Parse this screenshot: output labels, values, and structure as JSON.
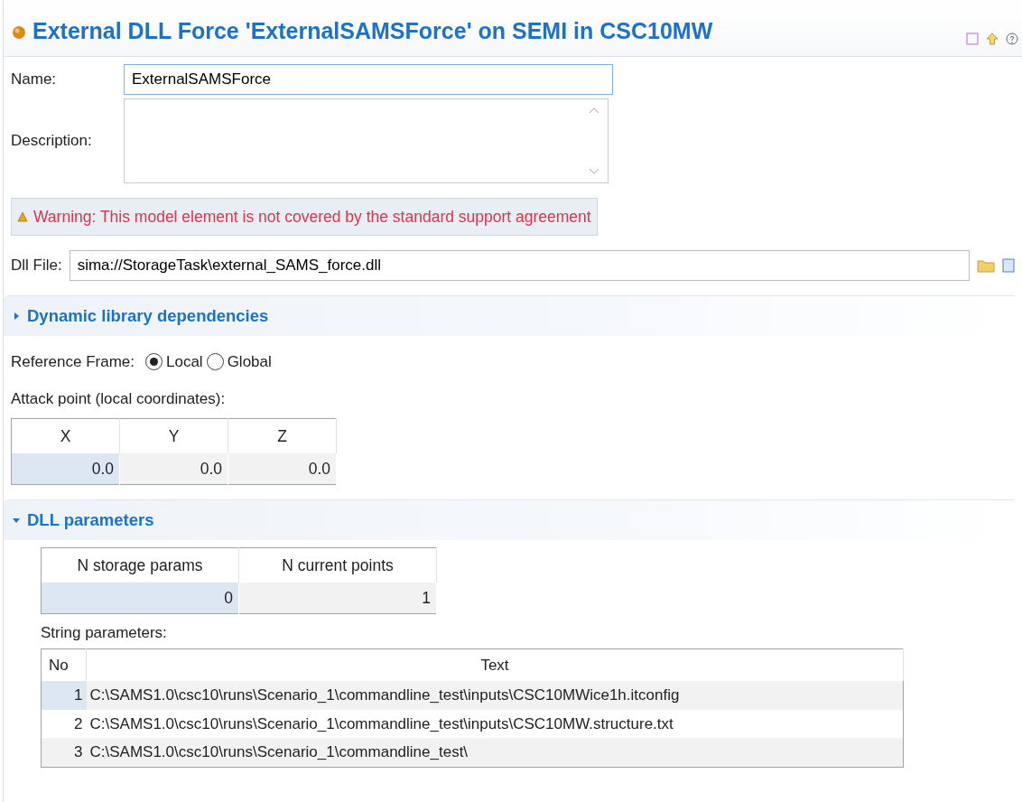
{
  "header": {
    "title": "External DLL Force 'ExternalSAMSForce' on SEMI in CSC10MW"
  },
  "name": {
    "label": "Name:",
    "value": "ExternalSAMSForce"
  },
  "description": {
    "label": "Description:"
  },
  "warning": {
    "text": "Warning: This model element is not covered by the standard support agreement"
  },
  "dll_file": {
    "label": "Dll File:",
    "value": "sima://StorageTask\\external_SAMS_force.dll"
  },
  "dependencies_section": {
    "title": "Dynamic library dependencies",
    "expanded": false
  },
  "reference_frame": {
    "label": "Reference Frame:",
    "options": [
      {
        "label": "Local",
        "selected": true
      },
      {
        "label": "Global",
        "selected": false
      }
    ]
  },
  "attack_point": {
    "label": "Attack point (local coordinates):",
    "columns": [
      "X",
      "Y",
      "Z"
    ],
    "cells": [
      {
        "value": "0.0",
        "selected": true
      },
      {
        "value": "0.0",
        "selected": false
      },
      {
        "value": "0.0",
        "selected": false
      }
    ]
  },
  "dll_parameters_section": {
    "title": "DLL parameters",
    "expanded": true
  },
  "counts_table": {
    "columns": [
      "N storage params",
      "N current points"
    ],
    "cells": [
      {
        "value": "0",
        "selected": true
      },
      {
        "value": "1",
        "selected": false
      }
    ]
  },
  "string_parameters": {
    "label": "String parameters:",
    "columns": [
      "No",
      "Text"
    ],
    "rows": [
      {
        "no": "1",
        "text": "C:\\SAMS1.0\\csc10\\runs\\Scenario_1\\commandline_test\\inputs\\CSC10MWice1h.itconfig",
        "selected": true
      },
      {
        "no": "2",
        "text": "C:\\SAMS1.0\\csc10\\runs\\Scenario_1\\commandline_test\\inputs\\CSC10MW.structure.txt",
        "selected": false
      },
      {
        "no": "3",
        "text": "C:\\SAMS1.0\\csc10\\runs\\Scenario_1\\commandline_test\\",
        "selected": false
      }
    ]
  }
}
